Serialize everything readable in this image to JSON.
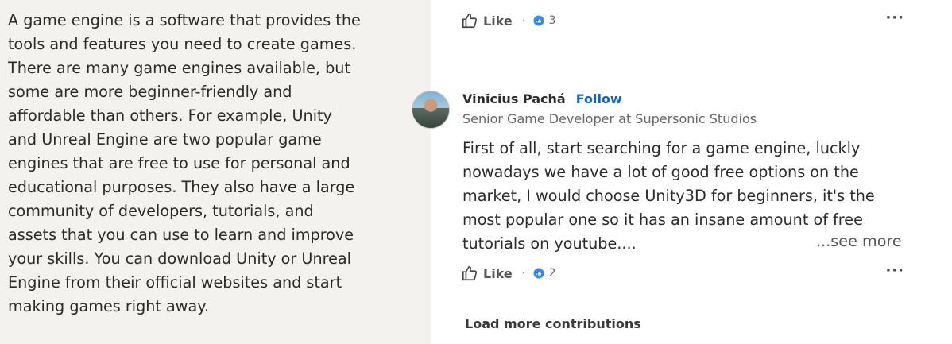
{
  "article": {
    "text": "A game engine is a software that provides the tools and features you need to create games. There are many game engines available, but some are more beginner-friendly and affordable than others. For example, Unity and Unreal Engine are two popular game engines that are free to use for personal and educational purposes. They also have a large community of developers, tutorials, and assets that you can use to learn and improve your skills. You can download Unity or Unreal Engine from their official websites and start making games right away."
  },
  "first_actions": {
    "like_label": "Like",
    "separator": "·",
    "reaction_count": "3",
    "more": "···"
  },
  "comment": {
    "author_name": "Vinicius Pachá",
    "follow_label": "Follow",
    "author_title": "Senior Game Developer at Supersonic Studios",
    "text": "First of all, start searching for a game engine, luckly nowadays we have a lot of good free options on the market, I would choose Unity3D for beginners, it's the most popular one so it has an insane amount of free tutorials on youtube....",
    "see_more": "...see more"
  },
  "second_actions": {
    "like_label": "Like",
    "separator": "·",
    "reaction_count": "2",
    "more": "···"
  },
  "footer": {
    "load_more": "Load more contributions"
  },
  "colors": {
    "accent": "#0a66c2",
    "left_bg": "#f4f2ee"
  },
  "icons": {
    "like": "thumbs-up-icon",
    "reaction": "like-reaction-icon",
    "more": "ellipsis-icon"
  }
}
